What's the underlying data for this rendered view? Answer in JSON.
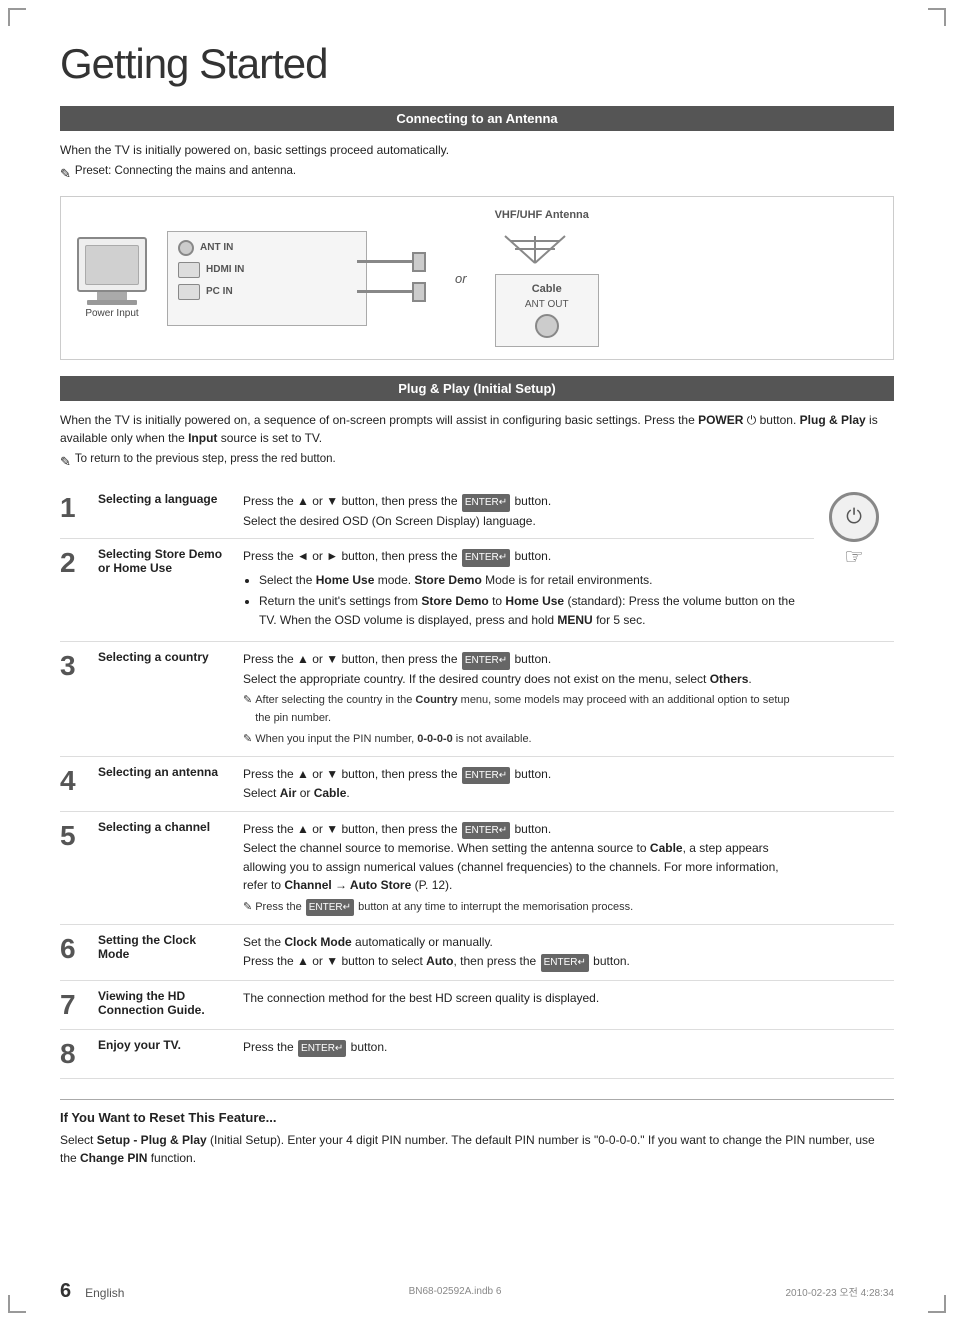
{
  "page": {
    "title": "Getting Started",
    "corners": true
  },
  "section1": {
    "header": "Connecting to an Antenna",
    "body1": "When the TV is initially powered on, basic settings proceed automatically.",
    "note": "Preset: Connecting the mains and antenna."
  },
  "section2": {
    "header": "Plug & Play (Initial Setup)",
    "body1": "When the TV is initially powered on, a sequence of on-screen prompts will assist in configuring basic settings. Press the POWER button. Plug & Play is available only when the Input source is set to TV.",
    "note": "To return to the previous step, press the red button."
  },
  "steps": [
    {
      "num": "1",
      "title": "Selecting a language",
      "content": "Press the ▲ or ▼ button, then press the ENTER button.\nSelect the desired OSD (On Screen Display) language."
    },
    {
      "num": "2",
      "title": "Selecting Store Demo or Home Use",
      "content_bullet1": "Select the Home Use mode. Store Demo Mode is for retail environments.",
      "content_bullet2": "Return the unit's settings from Store Demo to Home Use (standard): Press the volume button on the TV. When the OSD volume is displayed, press and hold MENU for 5 sec.",
      "intro": "Press the ◄ or ► button, then press the ENTER button."
    },
    {
      "num": "3",
      "title": "Selecting a country",
      "intro": "Press the ▲ or ▼ button, then press the ENTER button.",
      "content": "Select the appropriate country. If the desired country does not exist on the menu, select Others.",
      "note1": "After selecting the country in the Country menu, some models may proceed with an additional option to setup the pin number.",
      "note2": "When you input the PIN number, 0-0-0-0 is not available."
    },
    {
      "num": "4",
      "title": "Selecting an antenna",
      "intro": "Press the ▲ or ▼ button, then press the ENTER button.",
      "content": "Select Air or Cable."
    },
    {
      "num": "5",
      "title": "Selecting a channel",
      "intro": "Press the ▲ or ▼ button, then press the ENTER button.",
      "content": "Select the channel source to memorise. When setting the antenna source to Cable, a step appears allowing you to assign numerical values (channel frequencies) to the channels. For more information, refer to Channel → Auto Store (P. 12).",
      "note": "Press the ENTER button at any time to interrupt the memorisation process."
    },
    {
      "num": "6",
      "title": "Setting the Clock Mode",
      "content": "Set the Clock Mode automatically or manually.\nPress the ▲ or ▼ button to select Auto, then press the ENTER button."
    },
    {
      "num": "7",
      "title": "Viewing the HD Connection Guide.",
      "content": "The connection method for the best HD screen quality is displayed."
    },
    {
      "num": "8",
      "title": "Enjoy your TV.",
      "content": "Press the ENTER button."
    }
  ],
  "reset_section": {
    "title": "If You Want to Reset This Feature...",
    "body": "Select Setup - Plug & Play (Initial Setup). Enter your 4 digit PIN number. The default PIN number is \"0-0-0-0.\" If you want to change the PIN number, use the Change PIN function."
  },
  "footer": {
    "page_num": "6",
    "lang": "English",
    "file": "BN68-02592A.indb   6",
    "date": "2010-02-23   오전 4:28:34"
  },
  "labels": {
    "power_input": "Power Input",
    "ant_in": "ANT IN",
    "hdmi_in": "HDMI IN",
    "pc_in": "PC IN",
    "vhf_uhf": "VHF/UHF Antenna",
    "cable": "Cable",
    "ant_out": "ANT OUT",
    "or": "or",
    "enter_btn": "ENTER"
  }
}
